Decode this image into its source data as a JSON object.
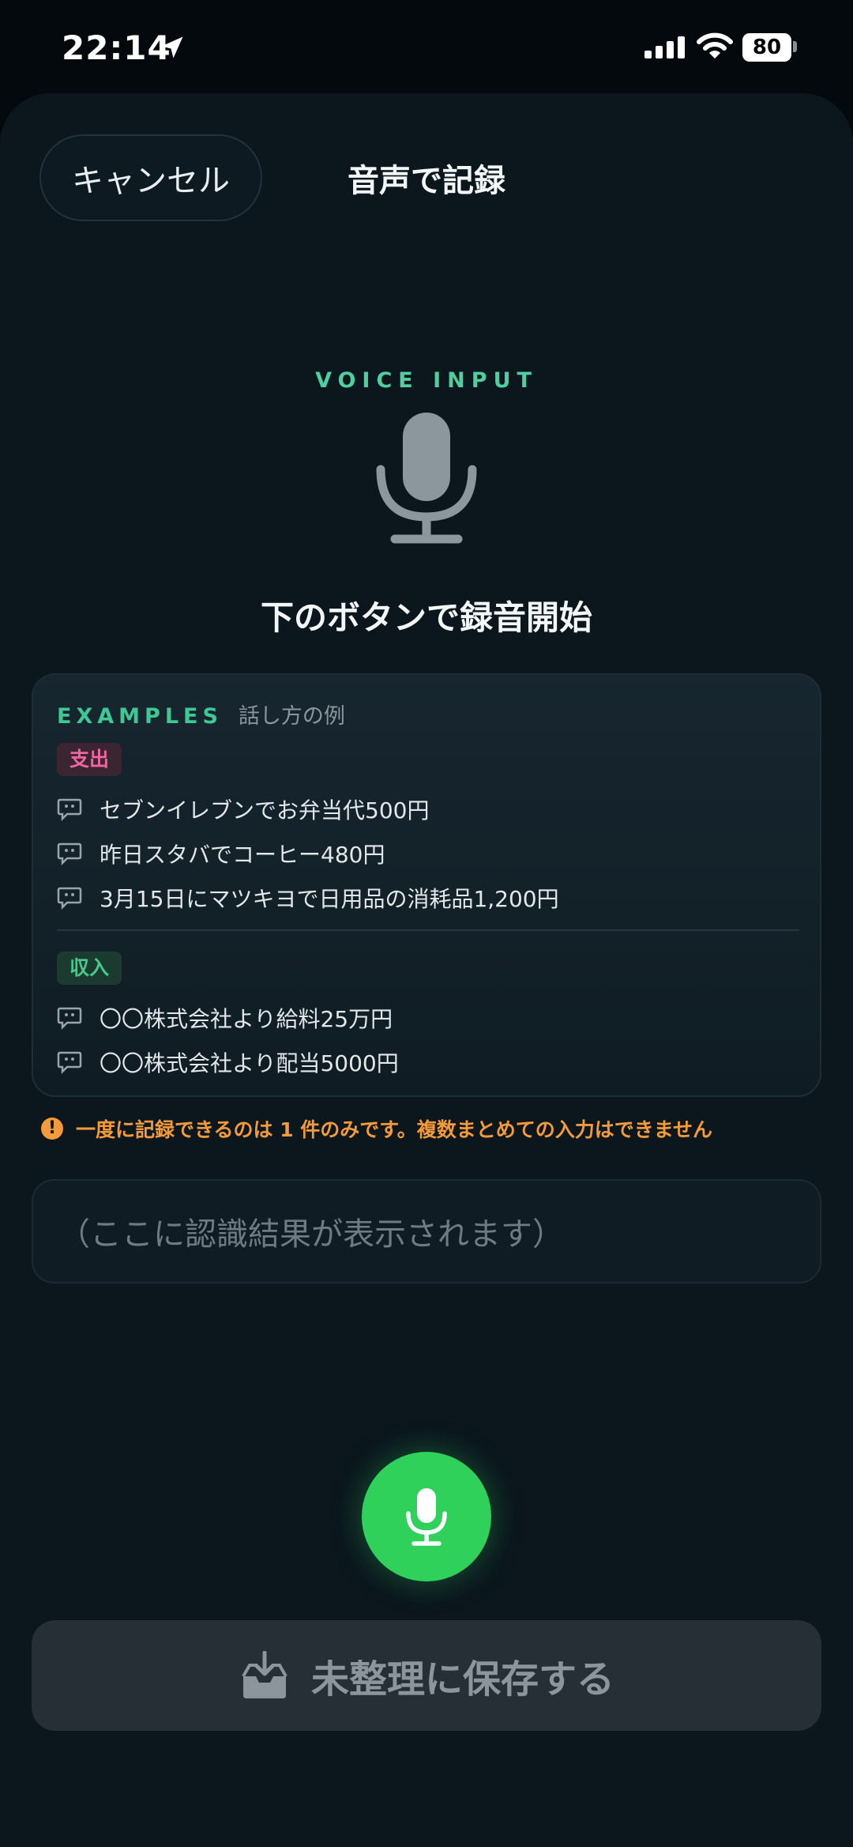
{
  "status": {
    "time": "22:14",
    "battery": "80"
  },
  "header": {
    "cancel_label": "キャンセル",
    "title": "音声で記録"
  },
  "voice": {
    "label": "VOICE INPUT",
    "instruction": "下のボタンで録音開始"
  },
  "examples": {
    "title": "EXAMPLES",
    "subtitle": "話し方の例",
    "expense_tag": "支出",
    "expense": [
      "セブンイレブンでお弁当代500円",
      "昨日スタバでコーヒー480円",
      "3月15日にマツキヨで日用品の消耗品1,200円"
    ],
    "income_tag": "収入",
    "income": [
      "〇〇株式会社より給料25万円",
      "〇〇株式会社より配当5000円"
    ]
  },
  "warning": {
    "icon": "!",
    "text": "一度に記録できるのは 1 件のみです。複数まとめての入力はできません"
  },
  "result": {
    "placeholder": "（ここに認識結果が表示されます）"
  },
  "save": {
    "label": "未整理に保存する"
  },
  "colors": {
    "accent": "#4fcf9e",
    "record": "#2fd15b",
    "warning": "#f39a3a",
    "expense": "#f064a0",
    "income": "#47c98a"
  },
  "icons": [
    "location-arrow-icon",
    "signal-icon",
    "wifi-icon",
    "battery-icon",
    "microphone-icon",
    "speech-bubble-icon",
    "warning-icon",
    "inbox-download-icon"
  ]
}
